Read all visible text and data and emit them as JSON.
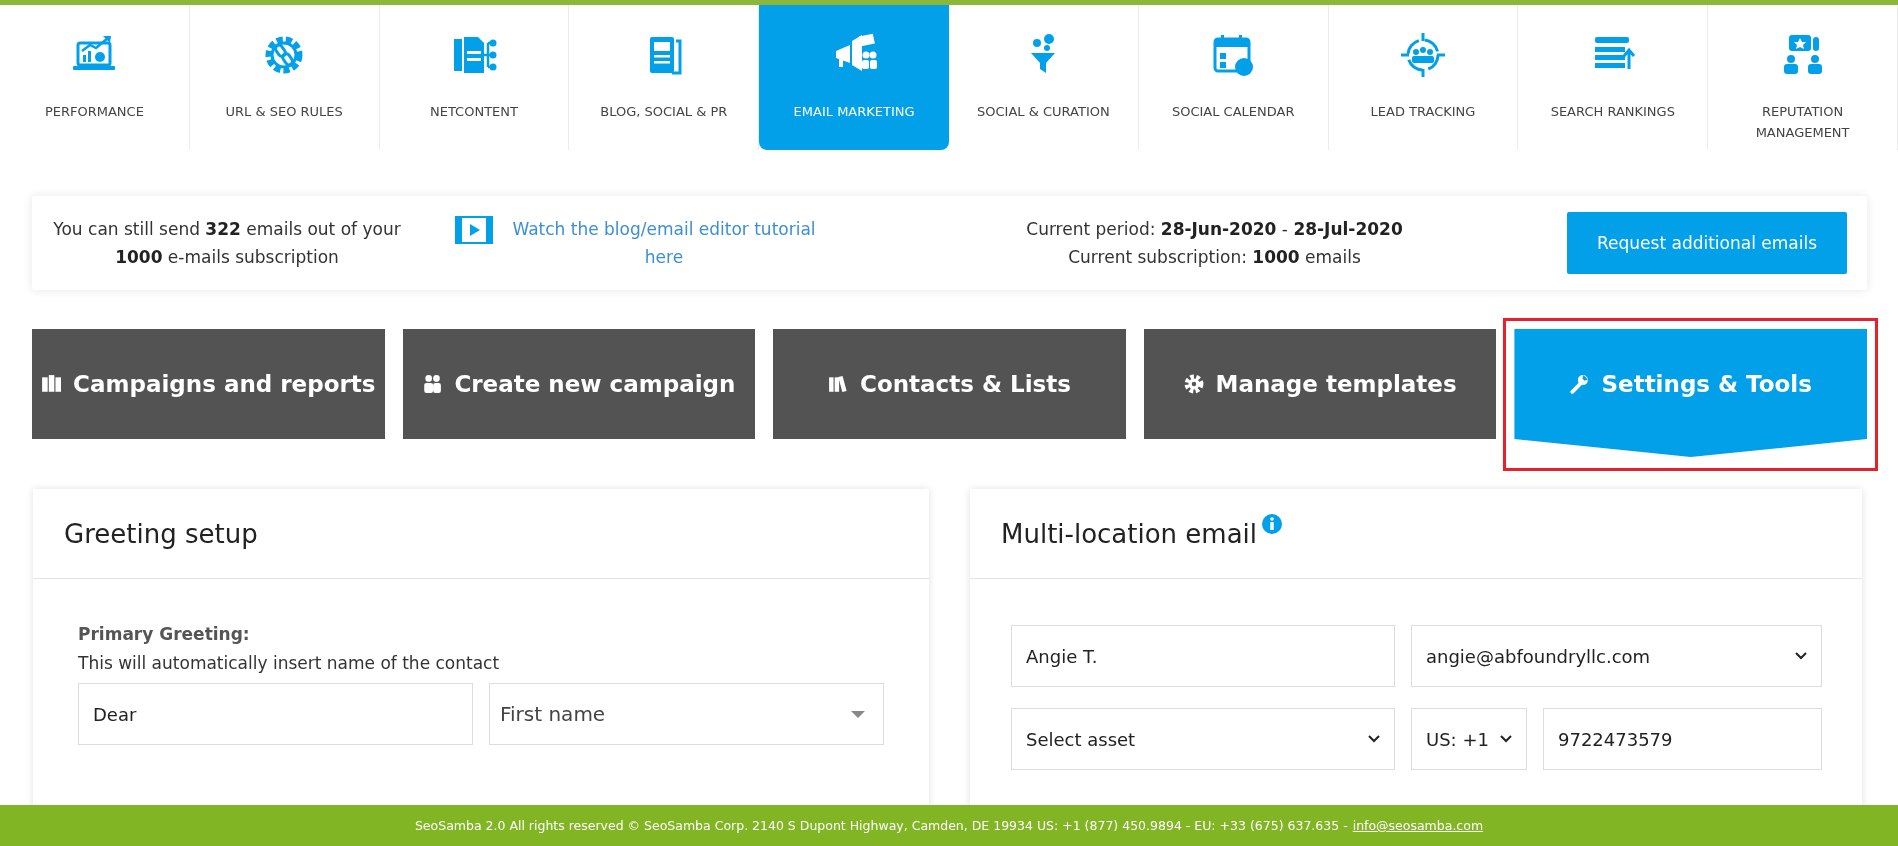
{
  "nav": {
    "items": [
      {
        "label": "PERFORMANCE",
        "selected": false
      },
      {
        "label": "URL & SEO RULES",
        "selected": false
      },
      {
        "label": "NETCONTENT",
        "selected": false
      },
      {
        "label": "BLOG, SOCIAL & PR",
        "selected": false
      },
      {
        "label": "EMAIL MARKETING",
        "selected": true
      },
      {
        "label": "SOCIAL & CURATION",
        "selected": false
      },
      {
        "label": "SOCIAL CALENDAR",
        "selected": false
      },
      {
        "label": "LEAD TRACKING",
        "selected": false
      },
      {
        "label": "SEARCH RANKINGS",
        "selected": false
      },
      {
        "label": "REPUTATION MANAGEMENT",
        "selected": false
      }
    ]
  },
  "quota": {
    "text": "You can still send **322** emails out of your **1000** e-mails subscription",
    "tutorial_link": "Watch the blog/email editor tutorial here",
    "period": "Current period: **28-Jun-2020** - **28-Jul-2020**",
    "subscription": "Current subscription: **1000** emails",
    "request_button": "Request additional emails"
  },
  "tabs": [
    {
      "label": "Campaigns and reports",
      "selected": false
    },
    {
      "label": "Create new campaign",
      "selected": false
    },
    {
      "label": "Contacts & Lists",
      "selected": false
    },
    {
      "label": "Manage templates",
      "selected": false
    },
    {
      "label": "Settings & Tools",
      "selected": true
    }
  ],
  "greeting_panel": {
    "title": "Greeting setup",
    "primary_label": "Primary Greeting:",
    "primary_hint": "This will automatically insert name of the contact",
    "greeting_value": "Dear",
    "name_select": "First name"
  },
  "multi_location_panel": {
    "title": "Multi-location email",
    "name_value": "Angie T.",
    "email_select": "angie@abfoundryllc.com",
    "asset_select": "Select asset",
    "country_select": "US: +1",
    "phone_value": "9722473579"
  },
  "footer": {
    "text": "SeoSamba 2.0  All rights reserved © SeoSamba Corp. 2140 S Dupont Highway, Camden, DE 19934 US: +1 (877) 450.9894 - EU: +33 (675) 637.635 -",
    "email_link": "info@seosamba.com"
  }
}
